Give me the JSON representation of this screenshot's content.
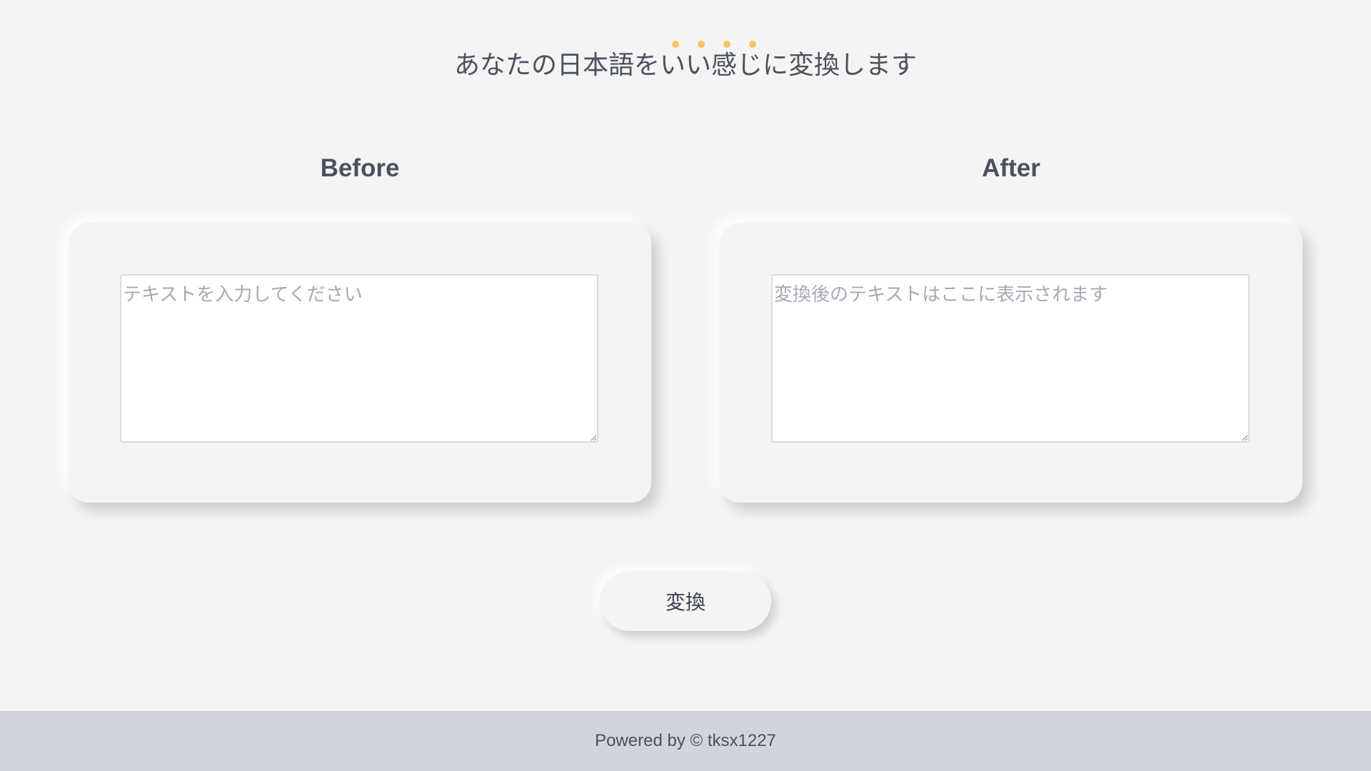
{
  "header": {
    "title": "あなたの日本語をいい感じに変換します",
    "dot_color": "#f6c560",
    "dot_count": 4
  },
  "before": {
    "label": "Before",
    "placeholder": "テキストを入力してください",
    "value": ""
  },
  "after": {
    "label": "After",
    "placeholder": "変換後のテキストはここに表示されます",
    "value": ""
  },
  "actions": {
    "convert_label": "変換"
  },
  "footer": {
    "text": "Powered by © tksx1227"
  },
  "colors": {
    "background": "#f4f4f4",
    "footer_background": "#d1d4dd",
    "text": "#4a525e",
    "accent": "#f6c560"
  }
}
